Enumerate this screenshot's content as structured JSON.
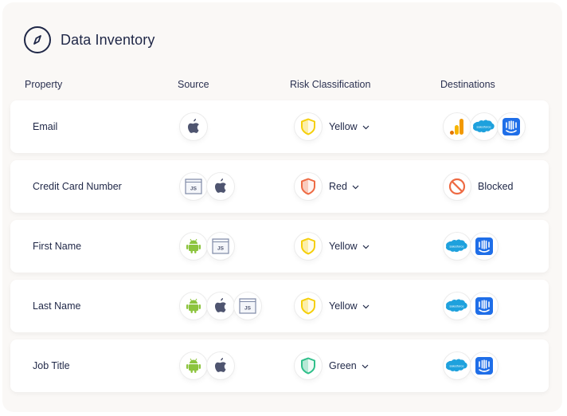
{
  "header": {
    "title": "Data Inventory",
    "icon": "compass-icon"
  },
  "columns": [
    "Property",
    "Source",
    "Risk Classification",
    "Destinations"
  ],
  "colors": {
    "yellow": "#f5cf0a",
    "red": "#ee6a43",
    "green": "#2fbf8a",
    "android": "#8cc43e",
    "apple": "#4f5570",
    "salesforce": "#1ea1dd",
    "intercom": "#1f6ee8",
    "analytics_orange": "#f29900",
    "blocked": "#ee6a43"
  },
  "rows": [
    {
      "property": "Email",
      "sources": [
        "apple"
      ],
      "risk": "Yellow",
      "risk_level": "yellow",
      "destinations": [
        "google-analytics",
        "salesforce",
        "intercom"
      ],
      "blocked": false
    },
    {
      "property": "Credit Card Number",
      "sources": [
        "js",
        "apple"
      ],
      "risk": "Red",
      "risk_level": "red",
      "destinations": [],
      "blocked": true,
      "blocked_label": "Blocked"
    },
    {
      "property": "First Name",
      "sources": [
        "android",
        "js"
      ],
      "risk": "Yellow",
      "risk_level": "yellow",
      "destinations": [
        "salesforce",
        "intercom"
      ],
      "blocked": false
    },
    {
      "property": "Last Name",
      "sources": [
        "android",
        "apple",
        "js"
      ],
      "risk": "Yellow",
      "risk_level": "yellow",
      "destinations": [
        "salesforce",
        "intercom"
      ],
      "blocked": false
    },
    {
      "property": "Job Title",
      "sources": [
        "android",
        "apple"
      ],
      "risk": "Green",
      "risk_level": "green",
      "destinations": [
        "salesforce",
        "intercom"
      ],
      "blocked": false
    }
  ]
}
